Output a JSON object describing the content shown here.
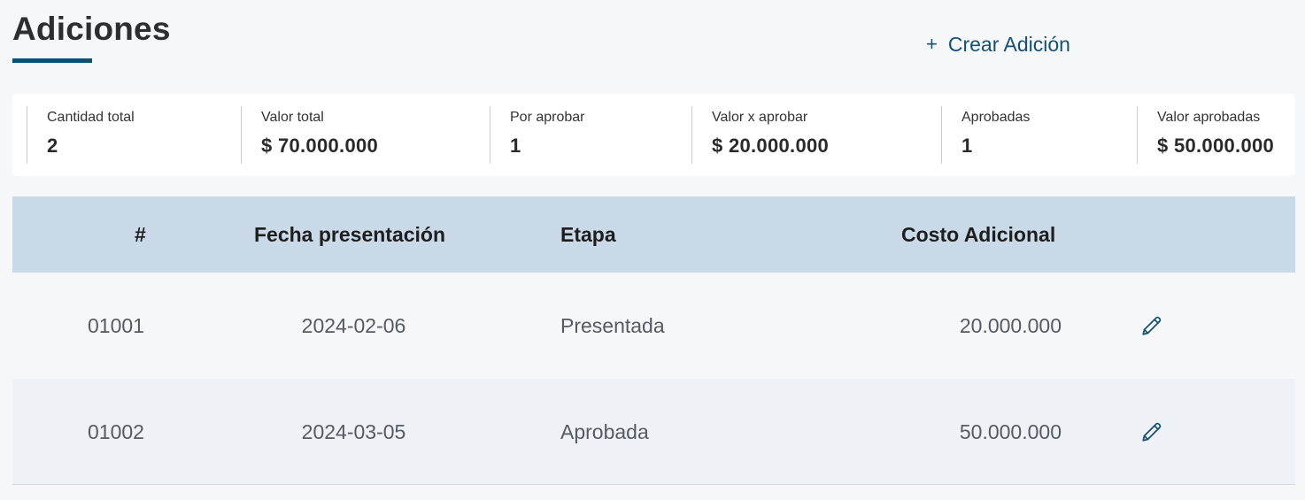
{
  "header": {
    "title": "Adiciones",
    "create_button": {
      "icon": "+",
      "label": "Crear Adición"
    }
  },
  "summary": [
    {
      "label": "Cantidad total",
      "value": "2"
    },
    {
      "label": "Valor total",
      "value": "$ 70.000.000"
    },
    {
      "label": "Por aprobar",
      "value": "1"
    },
    {
      "label": "Valor x aprobar",
      "value": "$ 20.000.000"
    },
    {
      "label": "Aprobadas",
      "value": "1"
    },
    {
      "label": "Valor aprobadas",
      "value": "$ 50.000.000"
    }
  ],
  "table": {
    "columns": [
      "#",
      "Fecha presentación",
      "Etapa",
      "Costo Adicional"
    ],
    "rows": [
      {
        "id": "01001",
        "fecha": "2024-02-06",
        "etapa": "Presentada",
        "costo": "20.000.000",
        "action_icon": "pencil-icon"
      },
      {
        "id": "01002",
        "fecha": "2024-03-05",
        "etapa": "Aprobada",
        "costo": "50.000.000",
        "action_icon": "pencil-icon"
      }
    ]
  },
  "colors": {
    "accent": "#0d4f6e",
    "header_bg": "#c9d9e8",
    "page_bg": "#f6f7f9"
  }
}
